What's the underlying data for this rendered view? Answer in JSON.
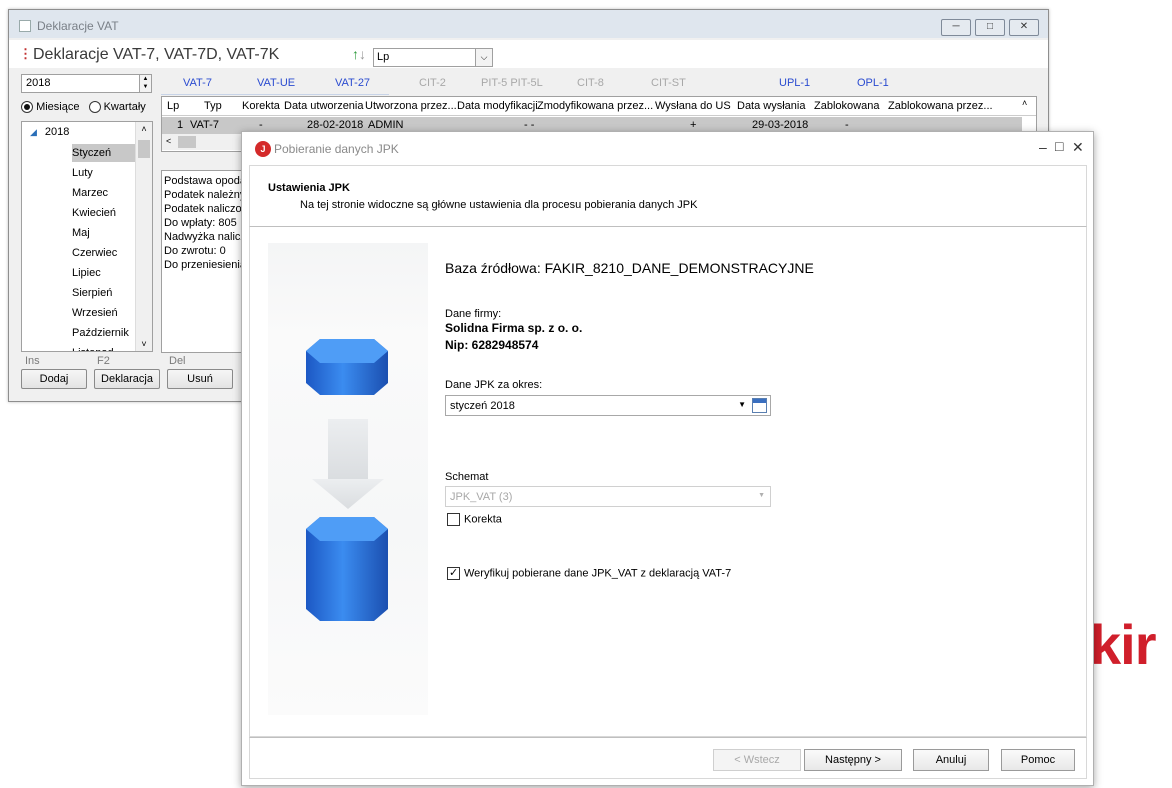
{
  "bg_window": {
    "title": "Deklaracje VAT",
    "header": "Deklaracje VAT-7, VAT-7D, VAT-7K",
    "sort_value": "Lp",
    "year": "2018",
    "radio_months": "Miesiące",
    "radio_quarters": "Kwartały",
    "tree_root": "2018",
    "months": [
      "Styczeń",
      "Luty",
      "Marzec",
      "Kwiecień",
      "Maj",
      "Czerwiec",
      "Lipiec",
      "Sierpień",
      "Wrzesień",
      "Październik",
      "Listopad"
    ],
    "tabs": [
      "VAT-7",
      "VAT-UE",
      "VAT-27",
      "CIT-2",
      "PIT-5 PIT-5L",
      "CIT-8",
      "CIT-ST",
      "UPL-1",
      "OPL-1"
    ],
    "columns": [
      "Lp",
      "Typ",
      "Korekta",
      "Data utworzenia",
      "Utworzona przez...",
      "Data modyfikacji",
      "Zmodyfikowana przez...",
      "Wysłana do US",
      "Data wysłania",
      "Zablokowana",
      "Zablokowana przez..."
    ],
    "row": {
      "lp": "1",
      "typ": "VAT-7",
      "korekta": "-",
      "data_utw": "28-02-2018",
      "utw_przez": "ADMIN",
      "data_mod": "- -",
      "wyslana": "+",
      "data_wysl": "29-03-2018",
      "zablok": "-"
    },
    "summary_lines": [
      "Podstawa opoda",
      "Podatek należny:",
      "Podatek naliczon",
      "Do wpłaty: 805",
      "Nadwyżka nalicz",
      "Do zwrotu: 0",
      "Do przeniesienia:"
    ],
    "key_hints": [
      "Ins",
      "F2",
      "Del"
    ],
    "buttons": [
      "Dodaj",
      "Deklaracja",
      "Usuń"
    ]
  },
  "logo_text": "kir",
  "dialog": {
    "title": "Pobieranie danych JPK",
    "header_title": "Ustawienia JPK",
    "header_subtitle": "Na tej stronie widoczne są główne ustawienia dla procesu pobierania danych JPK",
    "source_db": "Baza źródłowa: FAKIR_8210_DANE_DEMONSTRACYJNE",
    "company_label": "Dane firmy:",
    "company_name": "Solidna Firma sp. z o. o.",
    "company_nip": "Nip: 6282948574",
    "period_label": "Dane JPK za okres:",
    "period_value": "styczeń 2018",
    "schema_label": "Schemat",
    "schema_value": "JPK_VAT (3)",
    "correction_label": "Korekta",
    "correction_checked": false,
    "verify_label": "Weryfikuj pobierane dane JPK_VAT z deklaracją VAT-7",
    "verify_checked": true,
    "btn_back": "< Wstecz",
    "btn_next": "Następny >",
    "btn_cancel": "Anuluj",
    "btn_help": "Pomoc"
  }
}
